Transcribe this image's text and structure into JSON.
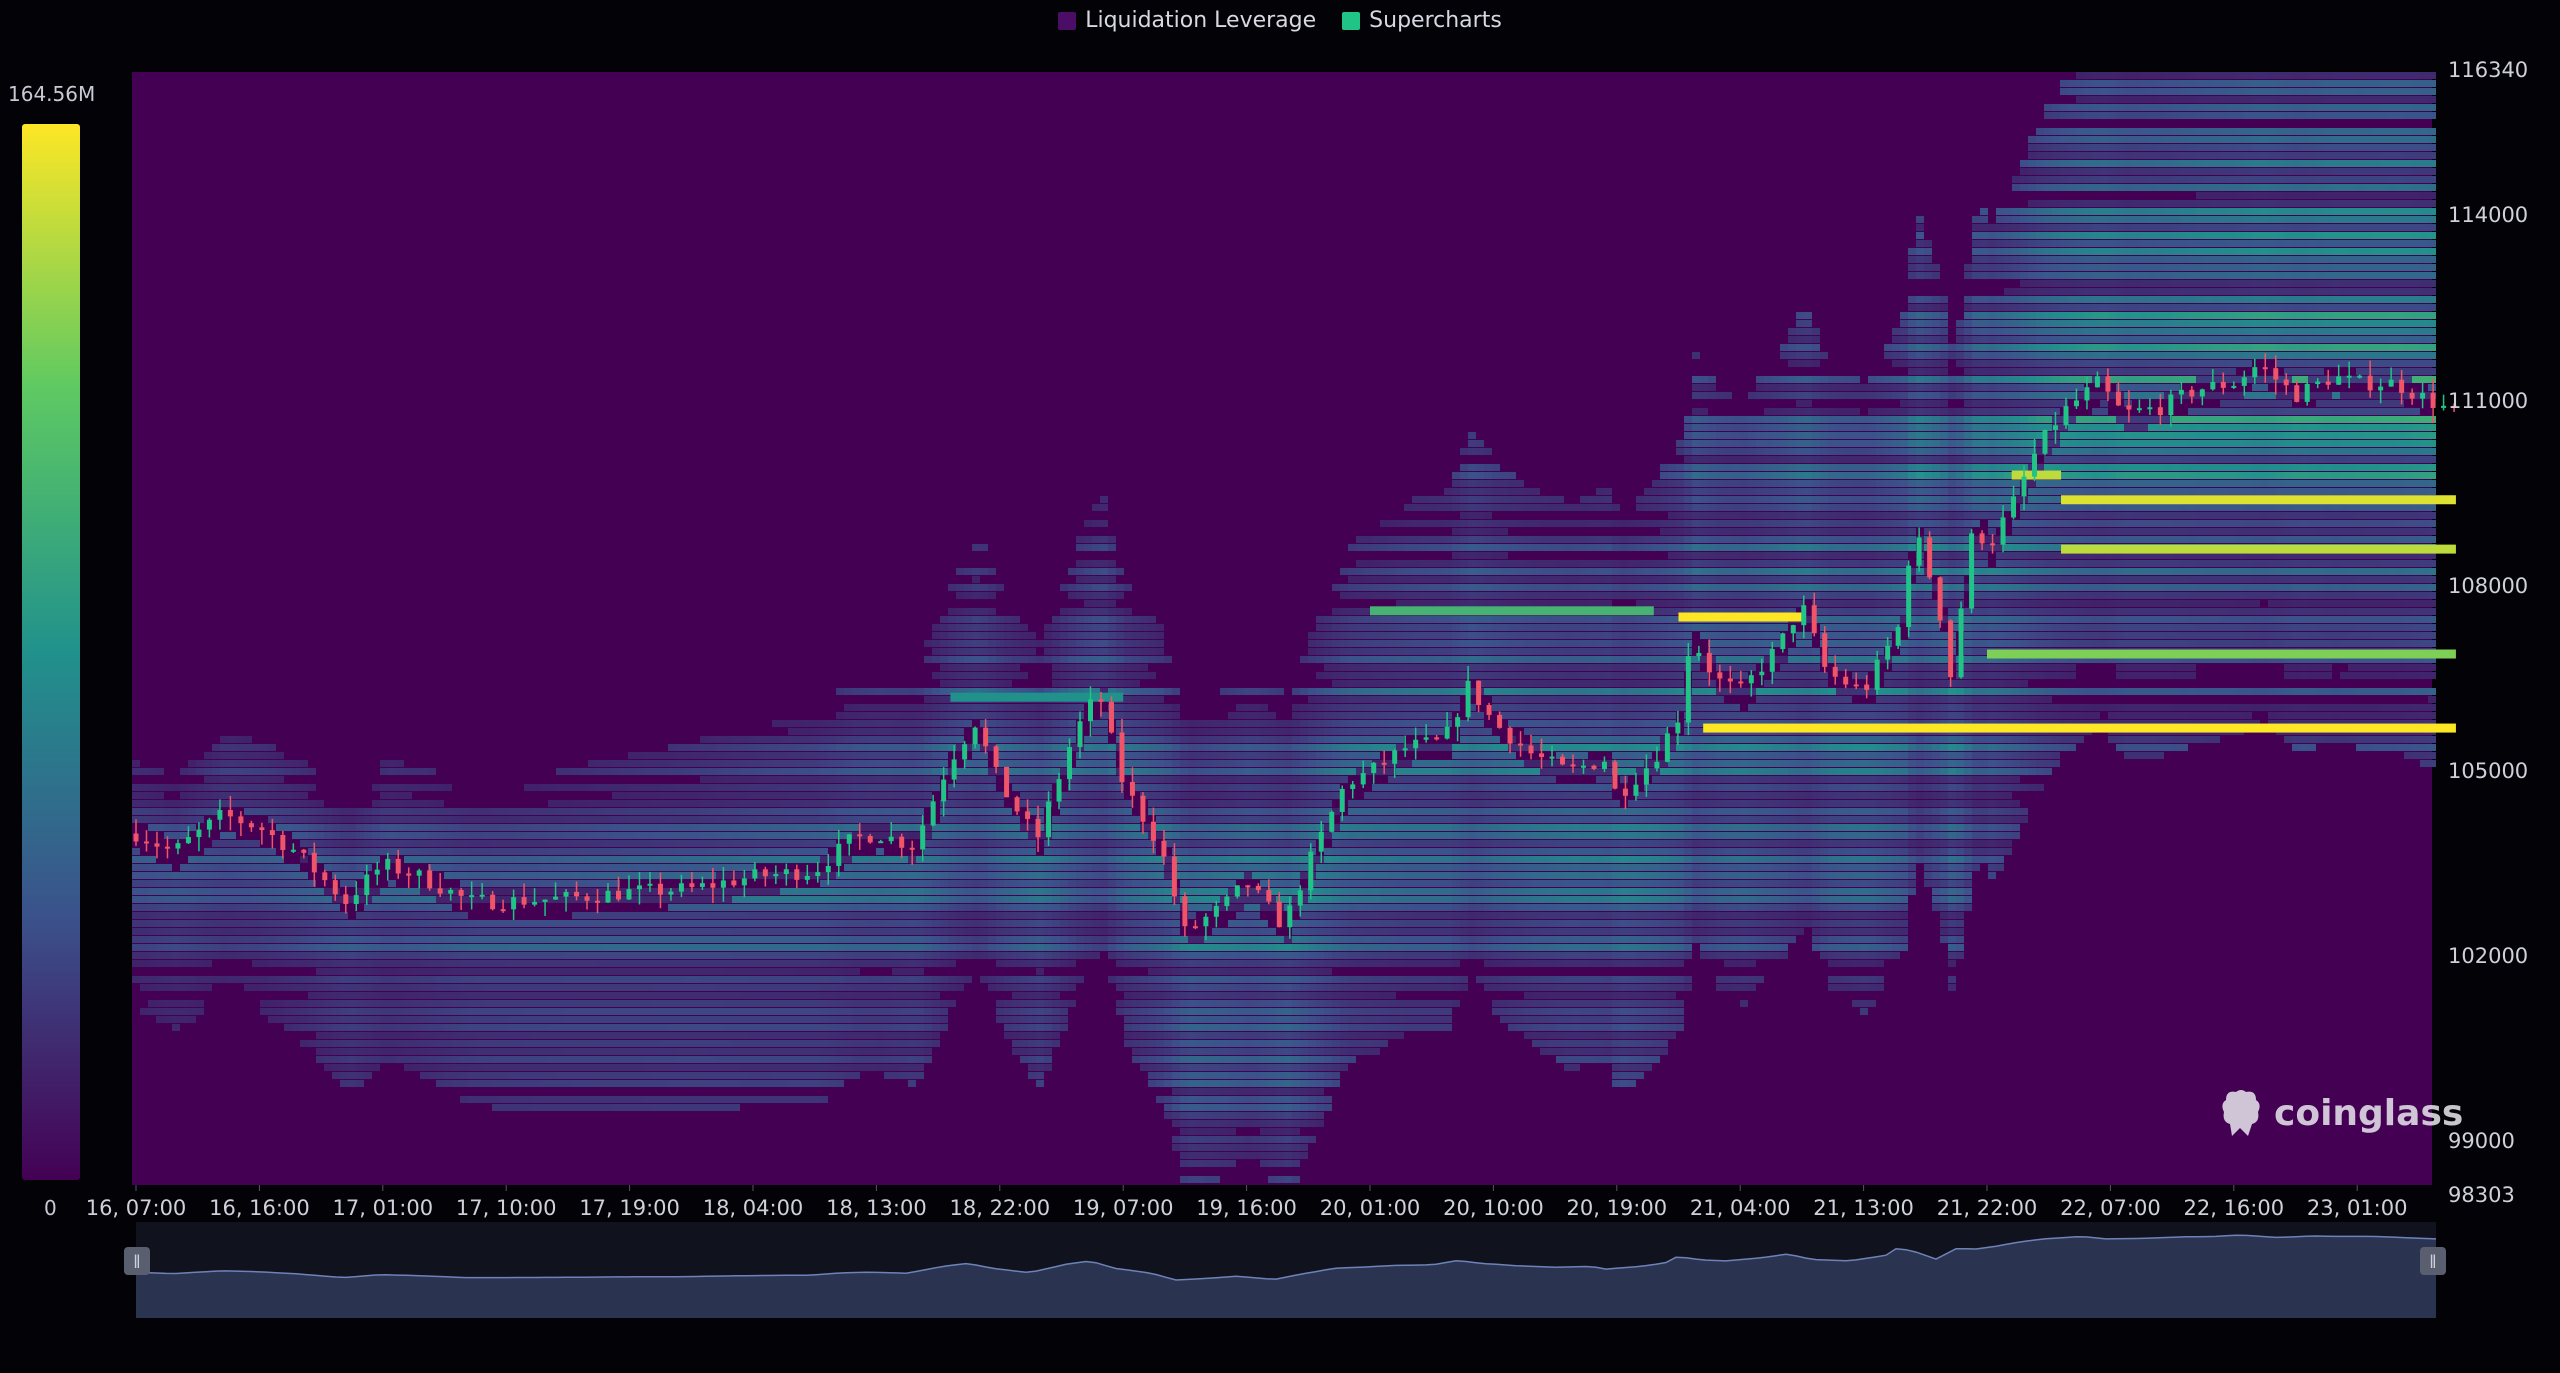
{
  "legend": [
    {
      "label": "Liquidation Leverage",
      "color": "#4b0d66"
    },
    {
      "label": "Supercharts",
      "color": "#1fc486"
    }
  ],
  "colorscale": {
    "max_label": "164.56M",
    "min_label": "0",
    "colors": [
      "#440154",
      "#3b528b",
      "#21918c",
      "#5ec962",
      "#fde725"
    ]
  },
  "watermark": "coinglass",
  "chart_data": {
    "type": "heatmap",
    "title": "",
    "series_names": [
      "Liquidation Leverage",
      "Supercharts"
    ],
    "y_axis": {
      "ticks": [
        116340,
        114000,
        111000,
        108000,
        105000,
        102000,
        99000,
        98303
      ],
      "range": [
        98303,
        116340
      ],
      "position": "right"
    },
    "x_axis": {
      "ticks": [
        "16, 07:00",
        "16, 16:00",
        "17, 01:00",
        "17, 10:00",
        "17, 19:00",
        "18, 04:00",
        "18, 13:00",
        "18, 22:00",
        "19, 07:00",
        "19, 16:00",
        "20, 01:00",
        "20, 10:00",
        "20, 19:00",
        "21, 04:00",
        "21, 13:00",
        "21, 22:00",
        "22, 07:00",
        "22, 16:00",
        "23, 01:00"
      ]
    },
    "colorbar": {
      "min": 0,
      "max": "164.56M"
    },
    "price_path": [
      {
        "t": 0,
        "p": 104000
      },
      {
        "t": 0.3,
        "p": 103700
      },
      {
        "t": 0.7,
        "p": 104300
      },
      {
        "t": 1,
        "p": 104100
      },
      {
        "t": 1.3,
        "p": 103700
      },
      {
        "t": 1.7,
        "p": 102900
      },
      {
        "t": 2,
        "p": 103500
      },
      {
        "t": 2.3,
        "p": 103300
      },
      {
        "t": 2.7,
        "p": 102900
      },
      {
        "t": 3,
        "p": 102900
      },
      {
        "t": 3.5,
        "p": 102950
      },
      {
        "t": 4,
        "p": 103050
      },
      {
        "t": 4.5,
        "p": 103100
      },
      {
        "t": 5,
        "p": 103300
      },
      {
        "t": 5.5,
        "p": 103400
      },
      {
        "t": 5.8,
        "p": 103900
      },
      {
        "t": 6,
        "p": 104000
      },
      {
        "t": 6.3,
        "p": 103800
      },
      {
        "t": 6.6,
        "p": 105200
      },
      {
        "t": 6.8,
        "p": 105800
      },
      {
        "t": 7,
        "p": 104800
      },
      {
        "t": 7.3,
        "p": 103900
      },
      {
        "t": 7.6,
        "p": 105600
      },
      {
        "t": 7.8,
        "p": 106300
      },
      {
        "t": 8,
        "p": 104800
      },
      {
        "t": 8.3,
        "p": 103800
      },
      {
        "t": 8.5,
        "p": 102400
      },
      {
        "t": 8.8,
        "p": 102800
      },
      {
        "t": 9,
        "p": 103200
      },
      {
        "t": 9.3,
        "p": 102500
      },
      {
        "t": 9.5,
        "p": 103500
      },
      {
        "t": 9.8,
        "p": 104800
      },
      {
        "t": 10,
        "p": 105000
      },
      {
        "t": 10.3,
        "p": 105400
      },
      {
        "t": 10.6,
        "p": 105500
      },
      {
        "t": 10.8,
        "p": 106400
      },
      {
        "t": 11,
        "p": 105800
      },
      {
        "t": 11.3,
        "p": 105300
      },
      {
        "t": 11.6,
        "p": 105000
      },
      {
        "t": 11.9,
        "p": 105200
      },
      {
        "t": 12,
        "p": 104600
      },
      {
        "t": 12.3,
        "p": 105200
      },
      {
        "t": 12.5,
        "p": 105900
      },
      {
        "t": 12.6,
        "p": 107200
      },
      {
        "t": 12.8,
        "p": 106500
      },
      {
        "t": 13,
        "p": 106300
      },
      {
        "t": 13.3,
        "p": 107000
      },
      {
        "t": 13.5,
        "p": 107700
      },
      {
        "t": 13.7,
        "p": 106600
      },
      {
        "t": 14,
        "p": 106300
      },
      {
        "t": 14.3,
        "p": 107400
      },
      {
        "t": 14.4,
        "p": 109000
      },
      {
        "t": 14.6,
        "p": 107800
      },
      {
        "t": 14.7,
        "p": 106500
      },
      {
        "t": 14.9,
        "p": 109100
      },
      {
        "t": 15,
        "p": 108600
      },
      {
        "t": 15.2,
        "p": 109300
      },
      {
        "t": 15.4,
        "p": 110200
      },
      {
        "t": 15.6,
        "p": 110800
      },
      {
        "t": 15.9,
        "p": 111300
      },
      {
        "t": 16.1,
        "p": 110800
      },
      {
        "t": 16.4,
        "p": 110900
      },
      {
        "t": 16.7,
        "p": 111200
      },
      {
        "t": 17,
        "p": 111300
      },
      {
        "t": 17.2,
        "p": 111600
      },
      {
        "t": 17.5,
        "p": 111100
      },
      {
        "t": 17.8,
        "p": 111400
      },
      {
        "t": 18,
        "p": 111300
      },
      {
        "t": 18.3,
        "p": 111300
      },
      {
        "t": 18.6,
        "p": 111000
      },
      {
        "t": 18.8,
        "p": 110800
      }
    ],
    "highlight_levels": [
      {
        "price": 107500,
        "from": 12.5,
        "to": 13.5,
        "intensity": 1
      },
      {
        "price": 105700,
        "from": 12.7,
        "to": 18.8,
        "intensity": 1
      },
      {
        "price": 109400,
        "from": 15.6,
        "to": 18.8,
        "intensity": 0.95
      },
      {
        "price": 108600,
        "from": 15.6,
        "to": 18.8,
        "intensity": 0.9
      },
      {
        "price": 106900,
        "from": 15,
        "to": 18.8,
        "intensity": 0.8
      },
      {
        "price": 107600,
        "from": 10,
        "to": 12.3,
        "intensity": 0.65
      },
      {
        "price": 109800,
        "from": 15.2,
        "to": 15.6,
        "intensity": 0.9
      },
      {
        "price": 106200,
        "from": 6.6,
        "to": 8,
        "intensity": 0.5
      }
    ]
  }
}
